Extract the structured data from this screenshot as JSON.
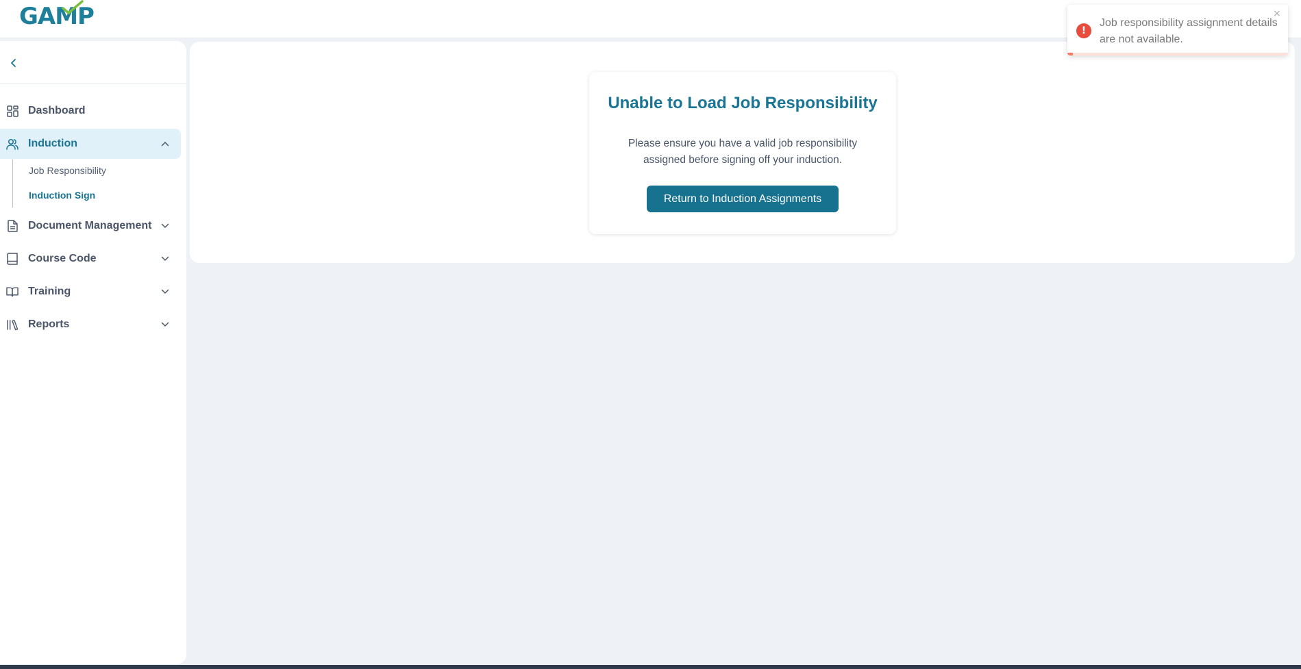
{
  "brand": {
    "logo_text": "GAMP",
    "accent": "#1a7595"
  },
  "sidebar": {
    "collapse_icon": "chevron-left-icon",
    "items": [
      {
        "label": "Dashboard",
        "icon": "dashboard-grid-icon",
        "expanded": false
      },
      {
        "label": "Induction",
        "icon": "users-icon",
        "expanded": true,
        "children": [
          {
            "label": "Job Responsibility"
          },
          {
            "label": "Induction Sign"
          }
        ]
      },
      {
        "label": "Document Management",
        "icon": "document-icon",
        "expanded": false
      },
      {
        "label": "Course Code",
        "icon": "book-icon",
        "expanded": false
      },
      {
        "label": "Training",
        "icon": "open-book-icon",
        "expanded": false
      },
      {
        "label": "Reports",
        "icon": "library-icon",
        "expanded": false
      }
    ]
  },
  "main": {
    "error_title": "Unable to Load Job Responsibility",
    "error_message": "Please ensure you have a valid job responsibility assigned before signing off your induction.",
    "return_button": "Return to Induction Assignments"
  },
  "toast": {
    "type": "error",
    "message": "Job responsibility assignment details are not available.",
    "close_symbol": "×",
    "alert_symbol": "!"
  }
}
